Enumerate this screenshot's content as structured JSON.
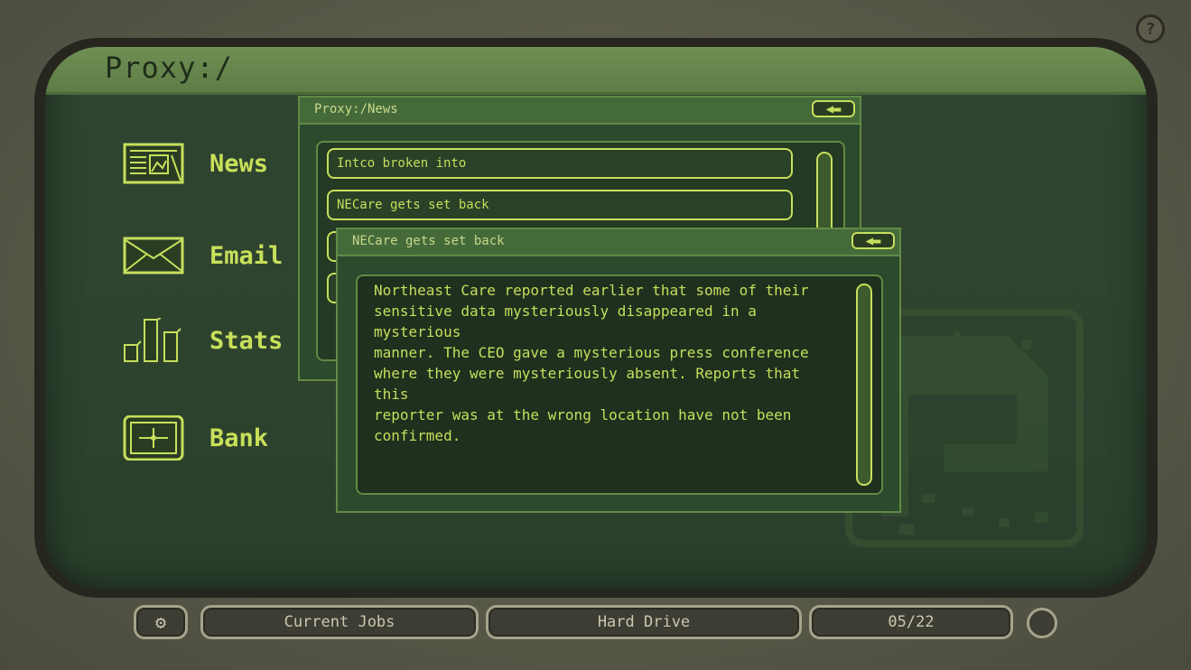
{
  "screen": {
    "title": "Proxy:/"
  },
  "apps": [
    {
      "label": "News",
      "icon": "newspaper-icon"
    },
    {
      "label": "Email",
      "icon": "envelope-icon"
    },
    {
      "label": "Stats",
      "icon": "bar-chart-icon"
    },
    {
      "label": "Bank",
      "icon": "card-icon"
    }
  ],
  "news_window": {
    "title": "Proxy:/News",
    "back_icon": "back-arrow-icon",
    "items": [
      "Intco broken into",
      "NECare gets set back"
    ]
  },
  "article_window": {
    "title": "NECare gets set back",
    "back_icon": "back-arrow-icon",
    "body": "Northeast Care reported earlier that some of their\nsensitive data mysteriously disappeared in a mysterious\nmanner. The CEO gave a mysterious press conference\nwhere they were mysteriously absent. Reports that this\nreporter was at the wrong location have not been\nconfirmed."
  },
  "taskbar": {
    "settings_icon": "gear-icon",
    "current_jobs": "Current Jobs",
    "hard_drive": "Hard Drive",
    "date": "05/22",
    "power_icon": "power-icon"
  },
  "help": {
    "label": "?"
  },
  "colors": {
    "accent": "#c6df5c",
    "screen": "#2f4530",
    "header": "#5c7d45",
    "bezel": "#26261f"
  }
}
